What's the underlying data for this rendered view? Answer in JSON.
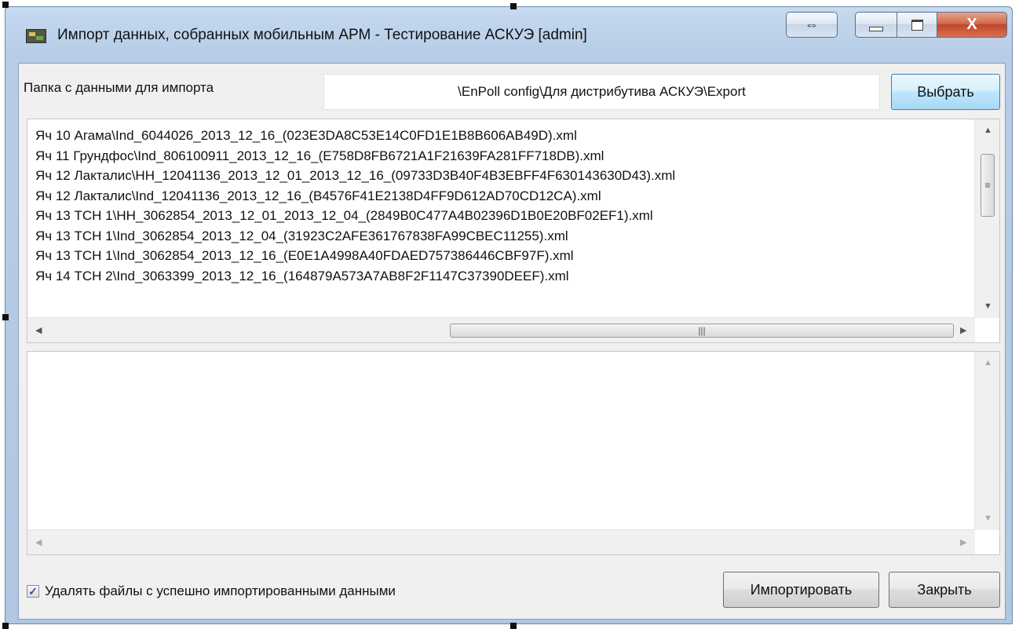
{
  "window": {
    "title": "Импорт данных, собранных мобильным АРМ - Тестирование АСКУЭ [admin]",
    "icon": "app-icon",
    "buttons": {
      "swap": "⇔",
      "minimize": "minimize-icon",
      "maximize": "maximize-icon",
      "close": "X"
    }
  },
  "folder": {
    "label": "Папка с данными для импорта",
    "value": "\\EnPoll config\\Для дистрибутива АСКУЭ\\Export",
    "browse_label": "Выбрать"
  },
  "file_list": {
    "items": [
      "Яч 10 Агама\\Ind_6044026_2013_12_16_(023E3DA8C53E14C0FD1E1B8B606AB49D).xml",
      "Яч 11 Грундфос\\Ind_806100911_2013_12_16_(E758D8FB6721A1F21639FA281FF718DB).xml",
      "Яч 12 Лакталис\\НН_12041136_2013_12_01_2013_12_16_(09733D3B40F4B3EBFF4F630143630D43).xml",
      "Яч 12 Лакталис\\Ind_12041136_2013_12_16_(B4576F41E2138D4FF9D612AD70CD12CA).xml",
      "Яч 13 ТСН 1\\НН_3062854_2013_12_01_2013_12_04_(2849B0C477A4B02396D1B0E20BF02EF1).xml",
      "Яч 13 ТСН 1\\Ind_3062854_2013_12_04_(31923C2AFE361767838FA99CBEC11255).xml",
      "Яч 13 ТСН 1\\Ind_3062854_2013_12_16_(E0E1A4998A40FDAED757386446CBF97F).xml",
      "Яч 14 ТСН 2\\Ind_3063399_2013_12_16_(164879A573A7AB8F2F1147C37390DEEF).xml"
    ]
  },
  "options": {
    "delete_files_label": "Удалять файлы с успешно импортированными данными",
    "delete_files_checked": true
  },
  "actions": {
    "import_label": "Импортировать",
    "close_label": "Закрыть"
  },
  "colors": {
    "title_bar": "#b9d0ea",
    "close_button": "#c74a2c",
    "active_button_border": "#3c7fb1"
  }
}
